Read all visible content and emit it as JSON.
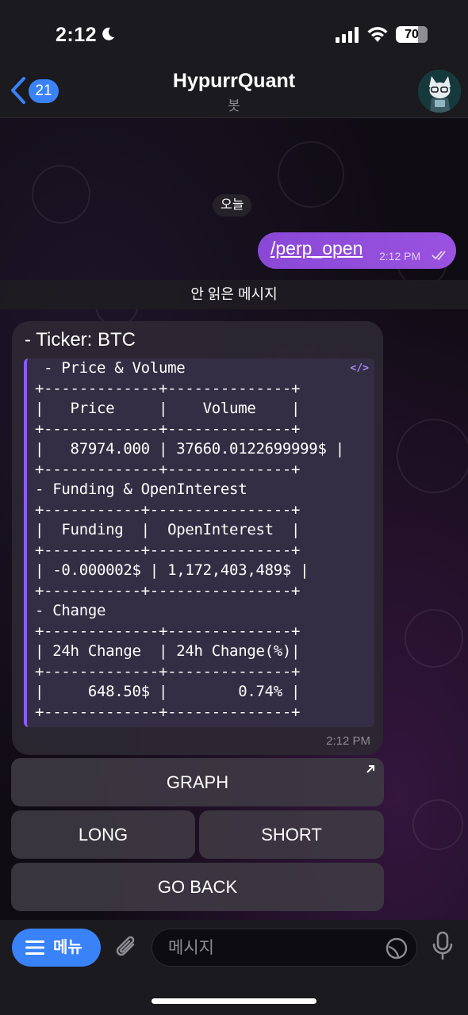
{
  "status_bar": {
    "time": "2:12",
    "battery": "70",
    "battery_level": 0.7
  },
  "header": {
    "back_count": "21",
    "title": "HypurrQuant",
    "subtitle": "봇"
  },
  "chat": {
    "date_label": "오늘",
    "outgoing": {
      "text": "/perp_open",
      "time": "2:12 PM"
    },
    "unread_label": "안 읽은 메시지",
    "incoming": {
      "title": "- Ticker: BTC",
      "code_lines": [
        " - Price & Volume",
        "+-------------+--------------+",
        "|   Price     |    Volume    |",
        "+-------------+--------------+",
        "|   87974.000 | 37660.0122699999$ |",
        "+-------------+--------------+",
        "- Funding & OpenInterest",
        "+-----------+----------------+",
        "|  Funding  |  OpenInterest  |",
        "+-----------+----------------+",
        "| -0.000002$ | 1,172,403,489$ |",
        "+-----------+----------------+",
        "- Change",
        "+-------------+--------------+",
        "| 24h Change  | 24h Change(%)|",
        "+-------------+--------------+",
        "|     648.50$ |        0.74% |",
        "+-------------+--------------+"
      ],
      "time": "2:12 PM"
    }
  },
  "keyboard": {
    "graph": "GRAPH",
    "long": "LONG",
    "short": "SHORT",
    "go_back": "GO BACK"
  },
  "input_bar": {
    "menu_label": "메뉴",
    "placeholder": "메시지"
  },
  "colors": {
    "accent": "#3a82f7",
    "outgoing_bubble": "#9a52e0",
    "code_border": "#8b5cf6"
  },
  "icons": [
    "moon-icon",
    "signal-icon",
    "wifi-icon",
    "back-chevron-icon",
    "code-icon",
    "external-arrow-icon",
    "menu-icon",
    "paperclip-icon",
    "sticker-icon",
    "microphone-icon"
  ]
}
